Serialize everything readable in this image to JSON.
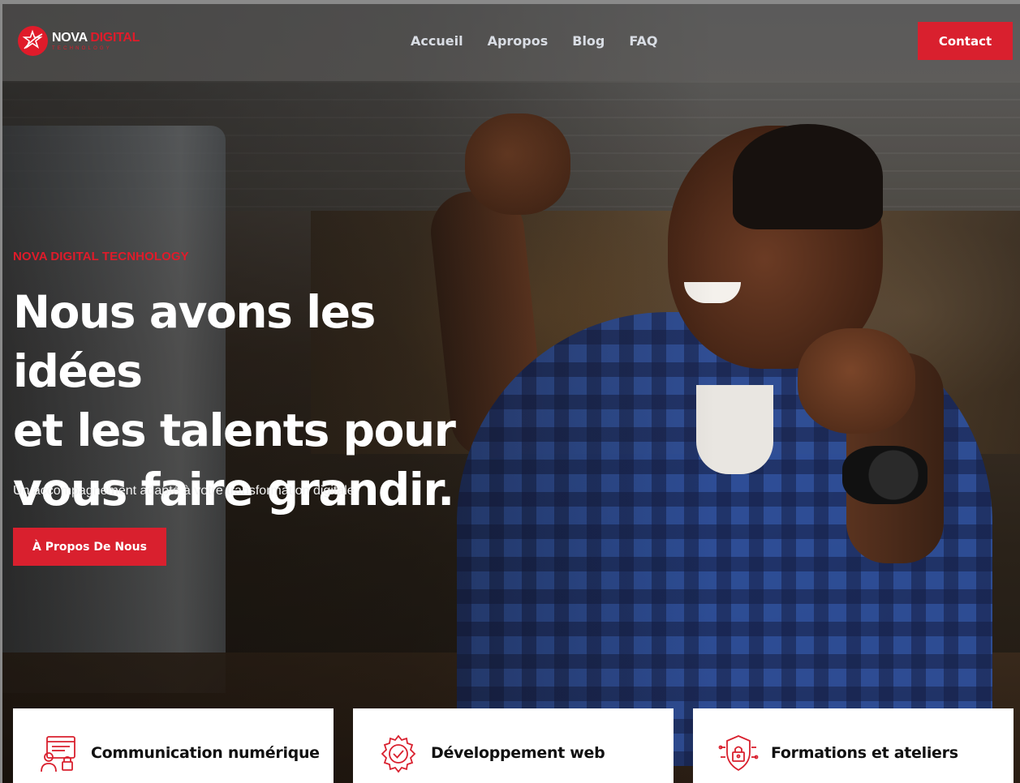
{
  "brand": {
    "logo_line1_a": "NOVA",
    "logo_line1_b": "DIGITAL",
    "logo_line2": "TECHNOLOGY",
    "accent_color": "#e01b2a"
  },
  "nav": {
    "items": [
      {
        "label": "Accueil"
      },
      {
        "label": "Apropos"
      },
      {
        "label": "Blog"
      },
      {
        "label": "FAQ"
      }
    ],
    "contact_label": "Contact"
  },
  "hero": {
    "eyebrow": "NOVA DIGITAL TECNHOLOGY",
    "headline_line1": "Nous avons les idées",
    "headline_line2": "et les talents pour",
    "headline_line3": "vous faire grandir.",
    "subline": "Un accompagnement adapté à votre transformation digitale",
    "cta_label": "À Propos De Nous"
  },
  "services": [
    {
      "title": "Communication numérique",
      "icon": "digital-communication-icon"
    },
    {
      "title": "Développement web",
      "icon": "gear-check-icon"
    },
    {
      "title": "Formations et ateliers",
      "icon": "shield-lock-icon"
    }
  ]
}
